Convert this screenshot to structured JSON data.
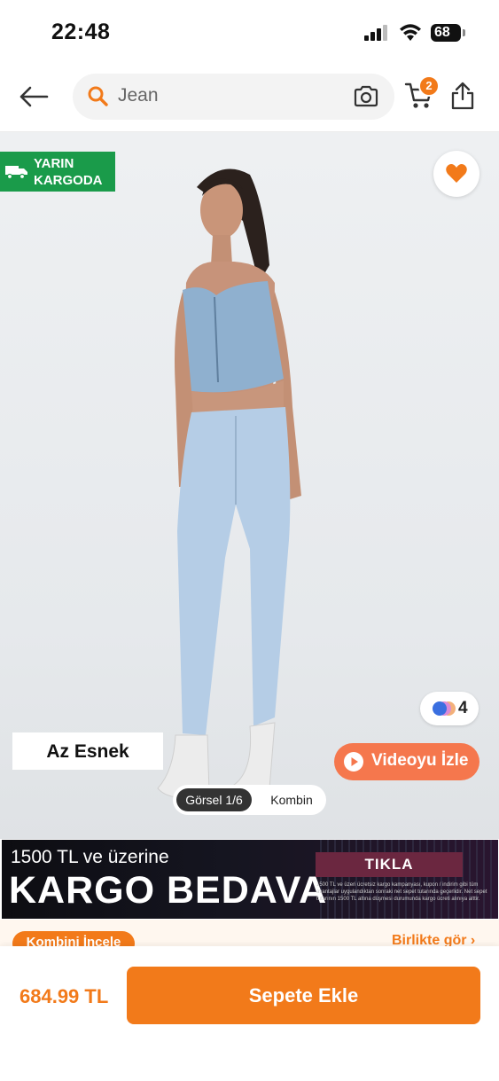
{
  "status_bar": {
    "time": "22:48",
    "battery": "68"
  },
  "header": {
    "search_value": "Jean",
    "cart_count": "2"
  },
  "product_image": {
    "shipping_badge": {
      "line1": "YARIN",
      "line2": "KARGODA"
    },
    "stretch_label": "Az Esnek",
    "color_count": "4",
    "video_label": "Videoyu İzle",
    "tabs": [
      {
        "label": "Görsel 1/6"
      },
      {
        "label": "Kombin"
      }
    ]
  },
  "promo_banner": {
    "line1": "1500 TL ve üzerine",
    "line2": "KARGO BEDAVA",
    "cta": "TIKLA",
    "fine_print": "1500 TL ve üzeri ücretsiz kargo kampanyası, kupon / indirim gibi tüm avantajlar uygulandıktan sonraki net sepet tutarında geçerlidir. Net sepet tutarının 1500 TL altına düşmesi durumunda kargo ücreti alınıya alttir."
  },
  "peek_row": {
    "kombin_label": "Kombini İncele",
    "together_label": "Birlikte gör"
  },
  "bottom_bar": {
    "price": "684.99 TL",
    "add_to_cart": "Sepete Ekle"
  },
  "colors": {
    "accent": "#f27a1a",
    "green_badge": "#1a9b4a",
    "video": "#f5774d"
  }
}
